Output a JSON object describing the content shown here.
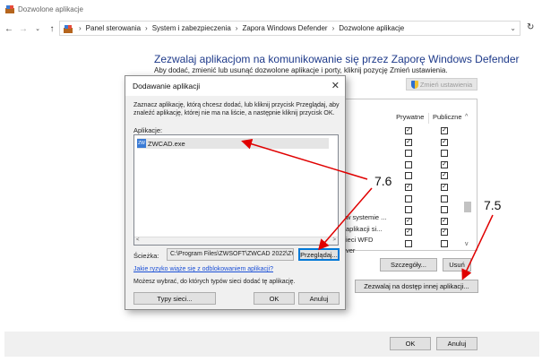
{
  "window": {
    "title": "Dozwolone aplikacje"
  },
  "address": {
    "crumbs": [
      "Panel sterowania",
      "System i zabezpieczenia",
      "Zapora Windows Defender",
      "Dozwolone aplikacje"
    ]
  },
  "main": {
    "title": "Zezwalaj aplikacjom na komunikowanie się przez Zaporę Windows Defender",
    "description": "Aby dodać, zmienić lub usunąć dozwolone aplikacje i porty, kliknij pozycję Zmień ustawienia.",
    "change_settings_label": "Zmień ustawienia",
    "columns": [
      "Prywatne",
      "Publiczne"
    ],
    "row_fragments": [
      "w systemie ...",
      "aplikacji si...",
      "ieci WFD",
      "ver"
    ],
    "rows": [
      {
        "private": true,
        "public": true
      },
      {
        "private": true,
        "public": true
      },
      {
        "private": false,
        "public": false
      },
      {
        "private": false,
        "public": true
      },
      {
        "private": false,
        "public": true
      },
      {
        "private": true,
        "public": true
      },
      {
        "private": false,
        "public": false
      },
      {
        "private": false,
        "public": false
      },
      {
        "private": true,
        "public": true
      },
      {
        "private": true,
        "public": true
      },
      {
        "private": false,
        "public": false
      }
    ],
    "details_label": "Szczegóły...",
    "remove_label": "Usuń",
    "allow_other_label": "Zezwalaj na dostęp innej aplikacji..."
  },
  "footer": {
    "ok_label": "OK",
    "cancel_label": "Anuluj"
  },
  "dialog": {
    "title": "Dodawanie aplikacji",
    "intro": "Zaznacz aplikację, którą chcesz dodać, lub kliknij przycisk Przeglądaj, aby znaleźć aplikację, której nie ma na liście, a następnie kliknij przycisk OK.",
    "apps_label": "Aplikacje:",
    "selected_app": "ZWCAD.exe",
    "path_label": "Ścieżka:",
    "path_value": "C:\\Program Files\\ZWSOFT\\ZWCAD 2022\\ZWC",
    "browse_label": "Przeglądaj...",
    "risk_link": "Jakie ryzyko wiąże się z odblokowaniem aplikacji?",
    "network_text": "Możesz wybrać, do których typów sieci dodać tę aplikację.",
    "network_types_label": "Typy sieci...",
    "ok_label": "OK",
    "cancel_label": "Anuluj"
  },
  "annotations": {
    "label_1": "7.6",
    "label_2": "7.5",
    "color": "#e00000"
  }
}
